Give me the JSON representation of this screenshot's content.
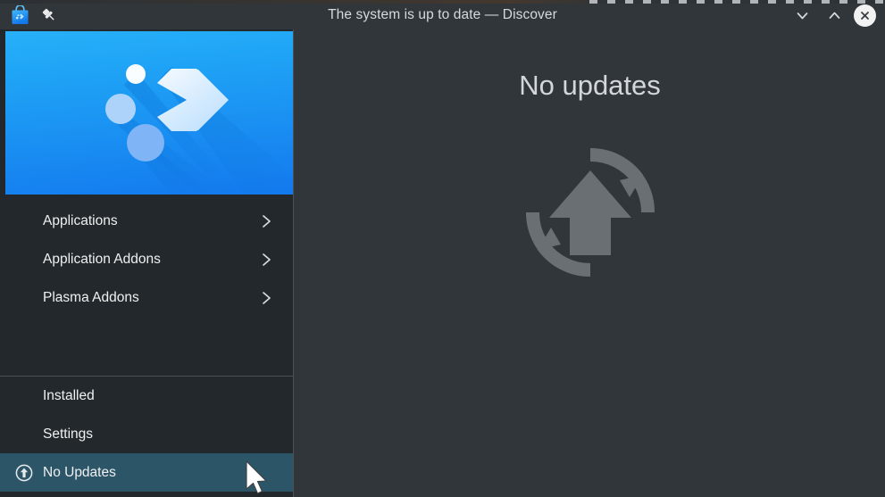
{
  "window": {
    "title": "The system is up to date — Discover",
    "app_icon": "discover-shopping-bag-icon",
    "pin_icon": "pin-icon",
    "controls": {
      "minimize_label": "Minimize",
      "maximize_label": "Maximize",
      "close_label": "Close"
    }
  },
  "sidebar": {
    "banner": {
      "name": "discover-logo-banner",
      "gradient_from": "#28b0f8",
      "gradient_to": "#1379ee"
    },
    "top_items": [
      {
        "label": "Applications",
        "icon": "chevron-right-icon"
      },
      {
        "label": "Application Addons",
        "icon": "chevron-right-icon"
      },
      {
        "label": "Plasma Addons",
        "icon": "chevron-right-icon"
      }
    ],
    "bottom_items": [
      {
        "label": "Installed",
        "icon": "",
        "active": false
      },
      {
        "label": "Settings",
        "icon": "",
        "active": false
      },
      {
        "label": "No Updates",
        "icon": "update-arrow-circle-icon",
        "active": true
      }
    ],
    "highlight_color": "#2c5668",
    "background_color": "#23282c"
  },
  "main": {
    "heading": "No updates",
    "graphic": "system-update-refresh-icon",
    "graphic_color": "#6a6f74",
    "background_color": "#31363b"
  },
  "cursor": {
    "name": "mouse-pointer"
  }
}
